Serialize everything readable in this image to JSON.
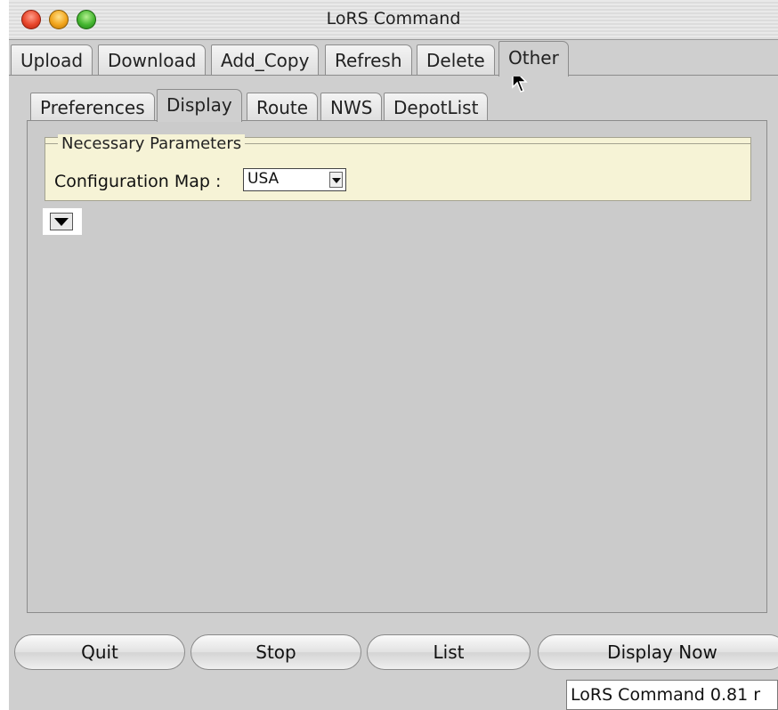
{
  "window": {
    "title": "LoRS Command"
  },
  "top_tabs": [
    {
      "label": "Upload"
    },
    {
      "label": "Download"
    },
    {
      "label": "Add_Copy"
    },
    {
      "label": "Refresh"
    },
    {
      "label": "Delete"
    },
    {
      "label": "Other",
      "active": true
    }
  ],
  "sub_tabs": [
    {
      "label": "Preferences"
    },
    {
      "label": "Display",
      "active": true
    },
    {
      "label": "Route"
    },
    {
      "label": "NWS"
    },
    {
      "label": "DepotList"
    }
  ],
  "group": {
    "title": "Necessary Parameters",
    "config_label": "Configuration Map :",
    "config_value": "USA"
  },
  "buttons": {
    "quit": "Quit",
    "stop": "Stop",
    "list": "List",
    "display_now": "Display Now"
  },
  "status": {
    "text": "LoRS Command 0.81 r"
  },
  "icons": {
    "close": "close-button-icon",
    "minimize": "minimize-button-icon",
    "zoom": "zoom-button-icon",
    "expand": "triangle-down-icon",
    "cursor": "mouse-pointer-icon"
  },
  "colors": {
    "window_bg": "#cfcfcf",
    "group_bg": "#f6f3d6",
    "close": "#e8462b",
    "minimize": "#f2a51c",
    "zoom": "#45b630"
  }
}
